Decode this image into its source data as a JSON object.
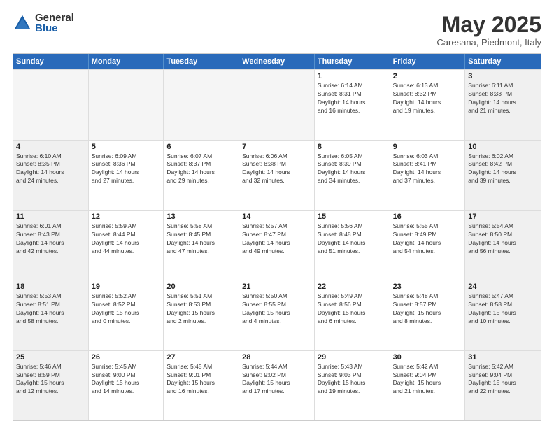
{
  "logo": {
    "general": "General",
    "blue": "Blue"
  },
  "title": "May 2025",
  "location": "Caresana, Piedmont, Italy",
  "header_days": [
    "Sunday",
    "Monday",
    "Tuesday",
    "Wednesday",
    "Thursday",
    "Friday",
    "Saturday"
  ],
  "rows": [
    [
      {
        "day": "",
        "empty": true
      },
      {
        "day": "",
        "empty": true
      },
      {
        "day": "",
        "empty": true
      },
      {
        "day": "",
        "empty": true
      },
      {
        "day": "1",
        "info": "Sunrise: 6:14 AM\nSunset: 8:31 PM\nDaylight: 14 hours\nand 16 minutes."
      },
      {
        "day": "2",
        "info": "Sunrise: 6:13 AM\nSunset: 8:32 PM\nDaylight: 14 hours\nand 19 minutes."
      },
      {
        "day": "3",
        "shaded": true,
        "info": "Sunrise: 6:11 AM\nSunset: 8:33 PM\nDaylight: 14 hours\nand 21 minutes."
      }
    ],
    [
      {
        "day": "4",
        "shaded": true,
        "info": "Sunrise: 6:10 AM\nSunset: 8:35 PM\nDaylight: 14 hours\nand 24 minutes."
      },
      {
        "day": "5",
        "info": "Sunrise: 6:09 AM\nSunset: 8:36 PM\nDaylight: 14 hours\nand 27 minutes."
      },
      {
        "day": "6",
        "info": "Sunrise: 6:07 AM\nSunset: 8:37 PM\nDaylight: 14 hours\nand 29 minutes."
      },
      {
        "day": "7",
        "info": "Sunrise: 6:06 AM\nSunset: 8:38 PM\nDaylight: 14 hours\nand 32 minutes."
      },
      {
        "day": "8",
        "info": "Sunrise: 6:05 AM\nSunset: 8:39 PM\nDaylight: 14 hours\nand 34 minutes."
      },
      {
        "day": "9",
        "info": "Sunrise: 6:03 AM\nSunset: 8:41 PM\nDaylight: 14 hours\nand 37 minutes."
      },
      {
        "day": "10",
        "shaded": true,
        "info": "Sunrise: 6:02 AM\nSunset: 8:42 PM\nDaylight: 14 hours\nand 39 minutes."
      }
    ],
    [
      {
        "day": "11",
        "shaded": true,
        "info": "Sunrise: 6:01 AM\nSunset: 8:43 PM\nDaylight: 14 hours\nand 42 minutes."
      },
      {
        "day": "12",
        "info": "Sunrise: 5:59 AM\nSunset: 8:44 PM\nDaylight: 14 hours\nand 44 minutes."
      },
      {
        "day": "13",
        "info": "Sunrise: 5:58 AM\nSunset: 8:45 PM\nDaylight: 14 hours\nand 47 minutes."
      },
      {
        "day": "14",
        "info": "Sunrise: 5:57 AM\nSunset: 8:47 PM\nDaylight: 14 hours\nand 49 minutes."
      },
      {
        "day": "15",
        "info": "Sunrise: 5:56 AM\nSunset: 8:48 PM\nDaylight: 14 hours\nand 51 minutes."
      },
      {
        "day": "16",
        "info": "Sunrise: 5:55 AM\nSunset: 8:49 PM\nDaylight: 14 hours\nand 54 minutes."
      },
      {
        "day": "17",
        "shaded": true,
        "info": "Sunrise: 5:54 AM\nSunset: 8:50 PM\nDaylight: 14 hours\nand 56 minutes."
      }
    ],
    [
      {
        "day": "18",
        "shaded": true,
        "info": "Sunrise: 5:53 AM\nSunset: 8:51 PM\nDaylight: 14 hours\nand 58 minutes."
      },
      {
        "day": "19",
        "info": "Sunrise: 5:52 AM\nSunset: 8:52 PM\nDaylight: 15 hours\nand 0 minutes."
      },
      {
        "day": "20",
        "info": "Sunrise: 5:51 AM\nSunset: 8:53 PM\nDaylight: 15 hours\nand 2 minutes."
      },
      {
        "day": "21",
        "info": "Sunrise: 5:50 AM\nSunset: 8:55 PM\nDaylight: 15 hours\nand 4 minutes."
      },
      {
        "day": "22",
        "info": "Sunrise: 5:49 AM\nSunset: 8:56 PM\nDaylight: 15 hours\nand 6 minutes."
      },
      {
        "day": "23",
        "info": "Sunrise: 5:48 AM\nSunset: 8:57 PM\nDaylight: 15 hours\nand 8 minutes."
      },
      {
        "day": "24",
        "shaded": true,
        "info": "Sunrise: 5:47 AM\nSunset: 8:58 PM\nDaylight: 15 hours\nand 10 minutes."
      }
    ],
    [
      {
        "day": "25",
        "shaded": true,
        "info": "Sunrise: 5:46 AM\nSunset: 8:59 PM\nDaylight: 15 hours\nand 12 minutes."
      },
      {
        "day": "26",
        "info": "Sunrise: 5:45 AM\nSunset: 9:00 PM\nDaylight: 15 hours\nand 14 minutes."
      },
      {
        "day": "27",
        "info": "Sunrise: 5:45 AM\nSunset: 9:01 PM\nDaylight: 15 hours\nand 16 minutes."
      },
      {
        "day": "28",
        "info": "Sunrise: 5:44 AM\nSunset: 9:02 PM\nDaylight: 15 hours\nand 17 minutes."
      },
      {
        "day": "29",
        "info": "Sunrise: 5:43 AM\nSunset: 9:03 PM\nDaylight: 15 hours\nand 19 minutes."
      },
      {
        "day": "30",
        "info": "Sunrise: 5:42 AM\nSunset: 9:04 PM\nDaylight: 15 hours\nand 21 minutes."
      },
      {
        "day": "31",
        "shaded": true,
        "info": "Sunrise: 5:42 AM\nSunset: 9:04 PM\nDaylight: 15 hours\nand 22 minutes."
      }
    ]
  ]
}
